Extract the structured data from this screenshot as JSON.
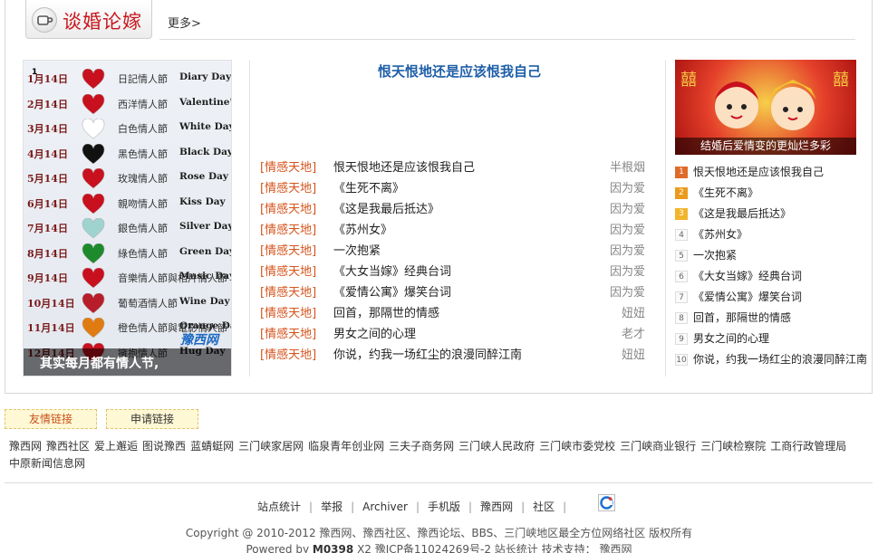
{
  "header": {
    "section_title": "谈婚论嫁",
    "more_link": "更多>"
  },
  "left_image": {
    "number": "1",
    "caption": "其实每月都有情人节,",
    "watermark": "豫西网",
    "rows": [
      {
        "month": "1月14日",
        "zh": "日記情人節",
        "en": "Diary Day",
        "color": "#c8101e"
      },
      {
        "month": "2月14日",
        "zh": "西洋情人節",
        "en": "Valentine's",
        "color": "#c8101e"
      },
      {
        "month": "3月14日",
        "zh": "白色情人節",
        "en": "White Day",
        "color": "#ffffff"
      },
      {
        "month": "4月14日",
        "zh": "黑色情人節",
        "en": "Black Day",
        "color": "#111111"
      },
      {
        "month": "5月14日",
        "zh": "玫瑰情人節",
        "en": "Rose Day",
        "color": "#c8101e"
      },
      {
        "month": "6月14日",
        "zh": "親吻情人節",
        "en": "Kiss Day",
        "color": "#c8101e"
      },
      {
        "month": "7月14日",
        "zh": "銀色情人節",
        "en": "Silver Day",
        "color": "#9fd3cf"
      },
      {
        "month": "8月14日",
        "zh": "綠色情人節",
        "en": "Green Day",
        "color": "#1d8a2c"
      },
      {
        "month": "9月14日",
        "zh": "音樂情人節與相片情人節",
        "en": "Music Day/Photo Day",
        "color": "#c8101e"
      },
      {
        "month": "10月14日",
        "zh": "葡萄酒情人節",
        "en": "Wine Day",
        "color": "#b71d2a"
      },
      {
        "month": "11月14日",
        "zh": "橙色情人節與電影情人節",
        "en": "Orange Day",
        "color": "#e07b12"
      },
      {
        "month": "12月14日",
        "zh": "擁抱情人節",
        "en": "Hug Day",
        "color": "#c8101e"
      }
    ]
  },
  "center": {
    "title": "恨天恨地还是应该恨我自己",
    "items": [
      {
        "category": "[情感天地]",
        "title": "恨天恨地还是应该恨我自己",
        "author": "半根烟"
      },
      {
        "category": "[情感天地]",
        "title": "《生死不离》",
        "author": "因为爱"
      },
      {
        "category": "[情感天地]",
        "title": "《这是我最后抵达》",
        "author": "因为爱"
      },
      {
        "category": "[情感天地]",
        "title": "《苏州女》",
        "author": "因为爱"
      },
      {
        "category": "[情感天地]",
        "title": "一次抱紧",
        "author": "因为爱"
      },
      {
        "category": "[情感天地]",
        "title": "《大女当嫁》经典台词",
        "author": "因为爱"
      },
      {
        "category": "[情感天地]",
        "title": "《爱情公寓》爆笑台词",
        "author": "因为爱"
      },
      {
        "category": "[情感天地]",
        "title": "回首，那隔世的情感",
        "author": "妞妞"
      },
      {
        "category": "[情感天地]",
        "title": "男女之间的心理",
        "author": "老才"
      },
      {
        "category": "[情感天地]",
        "title": "你说，约我一场红尘的浪漫同醉江南",
        "author": "妞妞"
      }
    ]
  },
  "right": {
    "image_caption": "结婚后爱情变的更灿烂多彩",
    "rank": [
      {
        "n": "1",
        "title": "恨天恨地还是应该恨我自己",
        "badge": "#e06a2a"
      },
      {
        "n": "2",
        "title": "《生死不离》",
        "badge": "#eb9a1c"
      },
      {
        "n": "3",
        "title": "《这是我最后抵达》",
        "badge": "#f1b52b"
      },
      {
        "n": "4",
        "title": "《苏州女》",
        "badge": ""
      },
      {
        "n": "5",
        "title": "一次抱紧",
        "badge": ""
      },
      {
        "n": "6",
        "title": "《大女当嫁》经典台词",
        "badge": ""
      },
      {
        "n": "7",
        "title": "《爱情公寓》爆笑台词",
        "badge": ""
      },
      {
        "n": "8",
        "title": "回首，那隔世的情感",
        "badge": ""
      },
      {
        "n": "9",
        "title": "男女之间的心理",
        "badge": ""
      },
      {
        "n": "10",
        "title": "你说，约我一场红尘的浪漫同醉江南",
        "badge": ""
      }
    ]
  },
  "links_section": {
    "friend_links_tab": "友情链接",
    "apply_link_tab": "申请链接",
    "links": [
      "豫西网",
      "豫西社区",
      "爱上邂逅",
      "图说豫西",
      "蓝蜻蜓网",
      "三门峡家居网",
      "临泉青年创业网",
      "三夫子商务网",
      "三门峡人民政府",
      "三门峡市委党校",
      "三门峡商业银行",
      "三门峡检察院",
      "工商行政管理局",
      "中原新闻信息网"
    ]
  },
  "footer": {
    "nav": [
      "站点统计",
      "举报",
      "Archiver",
      "手机版",
      "豫西网",
      "社区"
    ],
    "copyright": "Copyright  @  2010-2012  豫西网、豫西社区、豫西论坛、BBS、三门峡地区最全方位网络社区   版权所有",
    "powered_prefix": "Powered  by",
    "powered_brand": "M0398",
    "powered_ver": "X2",
    "icp": "豫ICP备11024269号-2",
    "stats": "站长统计",
    "support_label": "技术支持：",
    "support_name": "豫西网"
  }
}
